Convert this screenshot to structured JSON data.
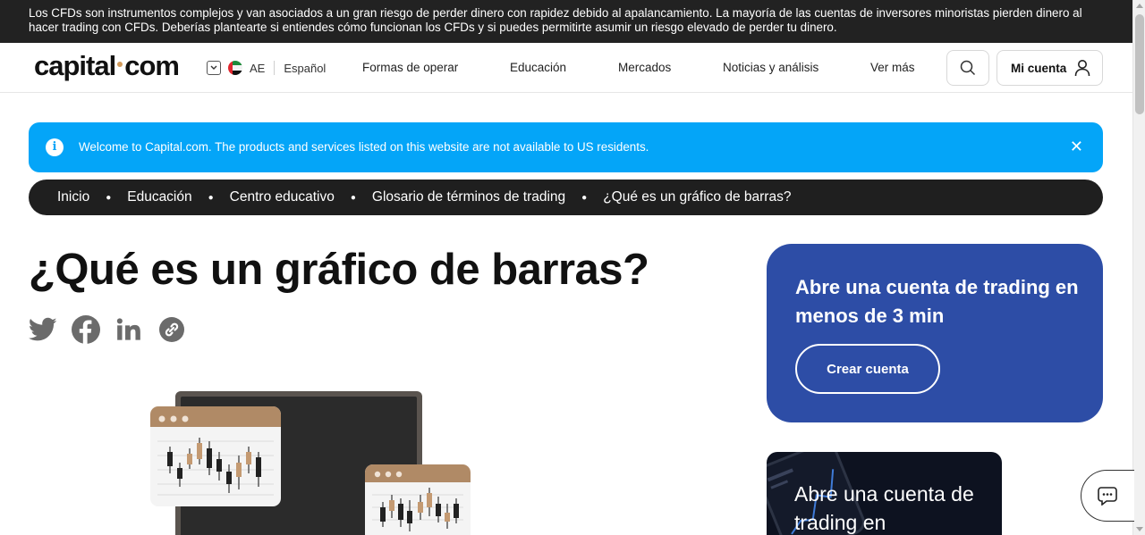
{
  "risk_warning": "Los CFDs son instrumentos complejos y van asociados a un gran riesgo de perder dinero con rapidez debido al apalancamiento. La mayoría de las cuentas de inversores minoristas pierden dinero al hacer trading con CFDs. Deberías plantearte si entiendes cómo funcionan los CFDs y si puedes permitirte asumir un riesgo elevado de perder tu dinero.",
  "header": {
    "logo_left": "capital",
    "logo_right": "com",
    "region_code": "AE",
    "language": "Español",
    "nav": [
      "Formas de operar",
      "Educación",
      "Mercados",
      "Noticias y análisis",
      "Ver más"
    ],
    "account_label": "Mi cuenta"
  },
  "info_bar": {
    "message": "Welcome to Capital.com. The products and services listed on this website are not available to US residents.",
    "info_glyph": "i",
    "close_glyph": "✕"
  },
  "breadcrumb": [
    "Inicio",
    "Educación",
    "Centro educativo",
    "Glosario de términos de trading",
    "¿Qué es un gráfico de barras?"
  ],
  "page": {
    "title": "¿Qué es un gráfico de barras?"
  },
  "share_icons": [
    "twitter-icon",
    "facebook-icon",
    "linkedin-icon",
    "link-icon"
  ],
  "cta_card": {
    "heading": "Abre una cuenta de trading en menos de 3 min",
    "button": "Crear cuenta"
  },
  "promo_card": {
    "text": "Abre una cuenta de trading en"
  },
  "colors": {
    "risk_bg": "#222222",
    "info_bg": "#04a5f8",
    "crumbs_bg": "#1f1f1f",
    "cta_bg": "#2d4da6",
    "logo_dot": "#d19a5a"
  }
}
